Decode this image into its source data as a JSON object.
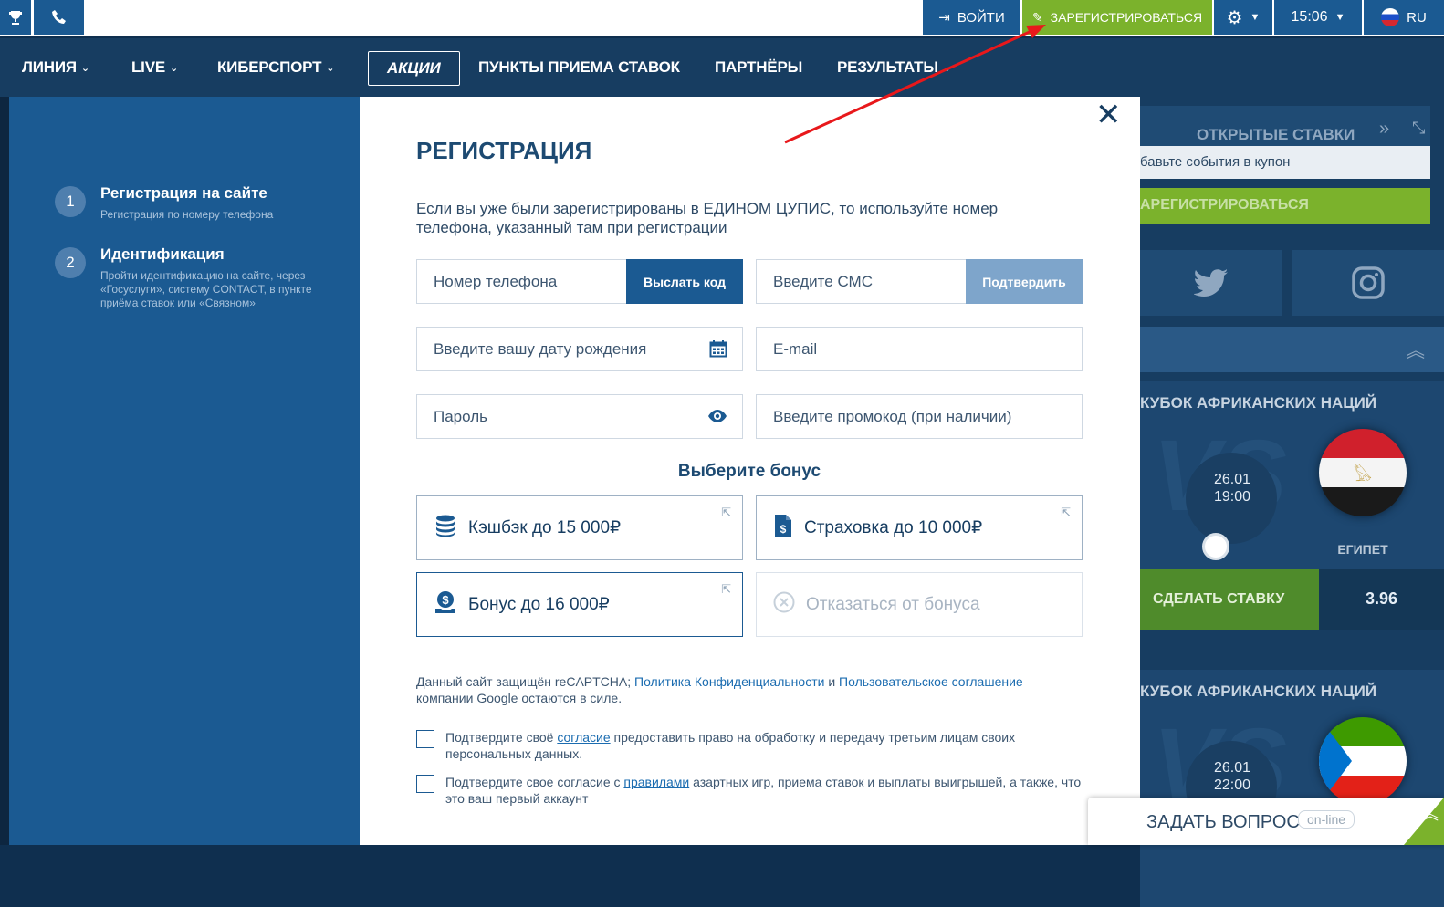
{
  "topbar": {
    "login_label": "ВОЙТИ",
    "register_label": "ЗАРЕГИСТРИРОВАТЬСЯ",
    "time": "15:06",
    "language": "RU"
  },
  "nav": {
    "items": [
      "ЛИНИЯ",
      "LIVE",
      "КИБЕРСПОРТ",
      "АКЦИИ",
      "ПУНКТЫ ПРИЕМА СТАВОК",
      "ПАРТНЁРЫ",
      "РЕЗУЛЬТАТЫ"
    ]
  },
  "steps": [
    {
      "num": "1",
      "title": "Регистрация на сайте",
      "desc": "Регистрация по номеру телефона"
    },
    {
      "num": "2",
      "title": "Идентификация",
      "desc": "Пройти идентификацию на сайте, через «Госуслуги», систему CONTACT, в пункте приёма ставок или «Связном»"
    }
  ],
  "modal": {
    "close": "✕",
    "title": "РЕГИСТРАЦИЯ",
    "note": "Если вы уже были зарегистрированы в ЕДИНОМ ЦУПИС, то используйте номер телефона, указанный там при регистрации",
    "phone_placeholder": "Номер телефона",
    "send_code": "Выслать код",
    "sms_placeholder": "Введите СМС",
    "confirm": "Подтвердить",
    "birth_placeholder": "Введите вашу дату рождения",
    "email_placeholder": "E-mail",
    "password_placeholder": "Пароль",
    "promo_placeholder": "Введите промокод (при наличии)",
    "bonus_heading": "Выберите бонус",
    "bonuses": [
      {
        "label": "Кэшбэк до 15 000₽"
      },
      {
        "label": "Страховка до 10 000₽"
      },
      {
        "label": "Бонус до 16 000₽"
      },
      {
        "label": "Отказаться от бонуса"
      }
    ],
    "captcha_a": "Данный сайт защищён reCAPTCHA; ",
    "captcha_link1": "Политика Конфиденциальности",
    "captcha_and": " и ",
    "captcha_link2": "Пользовательское соглашение",
    "captcha_b": " компании Google остаются в силе.",
    "agree1_a": "Подтвердите своё ",
    "agree1_link": "согласие",
    "agree1_b": " предоставить право на обработку и передачу третьим лицам своих персональных данных.",
    "agree2_a": "Подтвердите свое согласие с ",
    "agree2_link": "правилами",
    "agree2_b": " азартных игр, приема ставок и выплаты выигрышей, а также, что это ваш первый аккаунт"
  },
  "right": {
    "open_bets": "ОТКРЫТЫЕ СТАВКИ",
    "coupon_hint": "бавьте события в купон",
    "register": "АРЕГИСТРИРОВАТЬСЯ",
    "matches": [
      {
        "title": "КУБОК АФРИКАНСКИХ НАЦИЙ",
        "date": "26.01",
        "time": "19:00",
        "team": "ЕГИПЕТ",
        "bet": "СДЕЛАТЬ СТАВКУ",
        "odds": "3.96"
      },
      {
        "title": "КУБОК АФРИКАНСКИХ НАЦИЙ",
        "date": "26.01",
        "time": "22:00"
      }
    ],
    "vs": "VS"
  },
  "ask": {
    "label": "ЗАДАТЬ ВОПРОС",
    "badge": "on-line"
  },
  "colors": {
    "primary": "#1b5a92",
    "accent_green": "#7bb22c",
    "dark": "#173d61",
    "arrow": "#e8181b"
  }
}
